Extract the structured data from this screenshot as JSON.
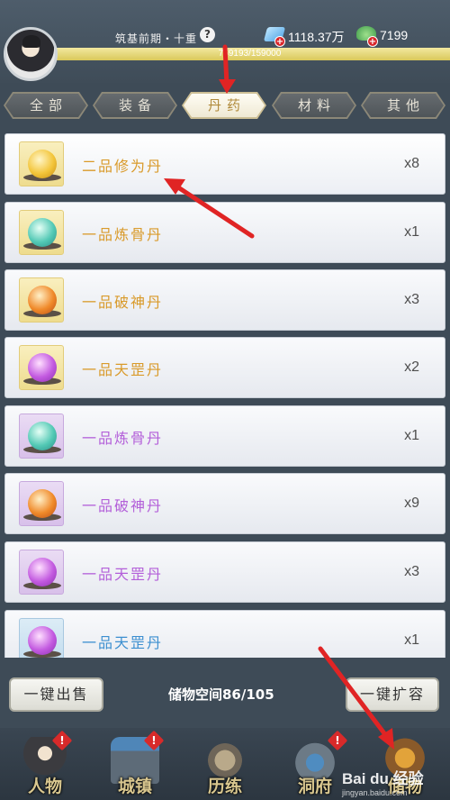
{
  "header": {
    "realm": "筑基前期・十重",
    "help": "?",
    "currency1": "1118.37万",
    "currency2": "7199",
    "plus": "+",
    "exp_text": "759193/159000",
    "exp_fill": 1.0
  },
  "tabs": [
    {
      "label": "全部",
      "active": false
    },
    {
      "label": "装备",
      "active": false
    },
    {
      "label": "丹药",
      "active": true
    },
    {
      "label": "材料",
      "active": false
    },
    {
      "label": "其他",
      "active": false
    }
  ],
  "items": [
    {
      "name": "二品修为丹",
      "qty": "x8",
      "frame": "yellow",
      "pill": "gold",
      "name_color": "#d99a2a"
    },
    {
      "name": "一品炼骨丹",
      "qty": "x1",
      "frame": "yellow",
      "pill": "teal",
      "name_color": "#d99a2a"
    },
    {
      "name": "一品破神丹",
      "qty": "x3",
      "frame": "yellow",
      "pill": "orange",
      "name_color": "#d99a2a"
    },
    {
      "name": "一品天罡丹",
      "qty": "x2",
      "frame": "yellow",
      "pill": "violet",
      "name_color": "#d99a2a"
    },
    {
      "name": "一品炼骨丹",
      "qty": "x1",
      "frame": "purple",
      "pill": "teal",
      "name_color": "#b35fd9"
    },
    {
      "name": "一品破神丹",
      "qty": "x9",
      "frame": "purple",
      "pill": "orange",
      "name_color": "#b35fd9"
    },
    {
      "name": "一品天罡丹",
      "qty": "x3",
      "frame": "purple",
      "pill": "violet",
      "name_color": "#b35fd9"
    },
    {
      "name": "一品天罡丹",
      "qty": "x1",
      "frame": "blue",
      "pill": "violet",
      "name_color": "#3c8fd0"
    }
  ],
  "bottom": {
    "sell_all": "一键出售",
    "storage": "储物空间86/105",
    "expand": "一键扩容"
  },
  "nav": [
    {
      "label": "人物",
      "alert": true
    },
    {
      "label": "城镇",
      "alert": true
    },
    {
      "label": "历练",
      "alert": false
    },
    {
      "label": "洞府",
      "alert": true
    },
    {
      "label": "储物",
      "alert": false
    }
  ],
  "alert_glyph": "!",
  "watermark": {
    "brand": "Bai du 经验",
    "url": "jingyan.baidu.com"
  },
  "colors": {
    "background": "#3e4b57",
    "tab_active_text": "#b08a3a",
    "gold_name": "#d99a2a",
    "purple_name": "#b35fd9",
    "blue_name": "#3c8fd0",
    "annotation_arrow": "#e02424"
  }
}
